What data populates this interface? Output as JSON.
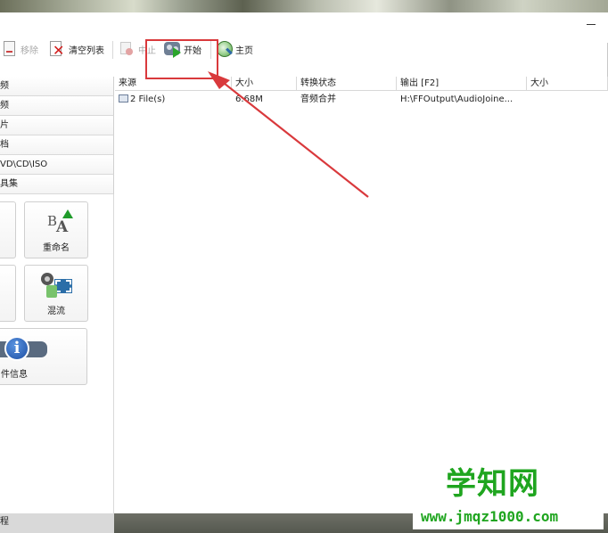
{
  "toolbar": {
    "remove_label": "移除",
    "clear_list_label": "清空列表",
    "stop_label": "中止",
    "start_label": "开始",
    "home_label": "主页"
  },
  "sidebar": {
    "categories": [
      "频",
      "频",
      "片",
      "档",
      "VD\\CD\\ISO",
      "具集"
    ],
    "tools": [
      {
        "label": "重命名",
        "icon": "rename-icon"
      },
      {
        "label": "混流",
        "icon": "mux-icon"
      },
      {
        "label": "件信息",
        "icon": "info-icon"
      }
    ]
  },
  "list": {
    "columns": [
      "来源",
      "大小",
      "转换状态",
      "输出 [F2]",
      "大小"
    ],
    "rows": [
      {
        "source": "2 File(s)",
        "size": "6.68M",
        "status": "音频合并",
        "output": "H:\\FFOutput\\AudioJoine...",
        "output_size": ""
      }
    ]
  },
  "statusbar": {
    "left_text": "程"
  },
  "watermark": {
    "title": "学知网",
    "url": "www.jmqz1000.com"
  },
  "annotation": {
    "color": "#d9393c"
  }
}
